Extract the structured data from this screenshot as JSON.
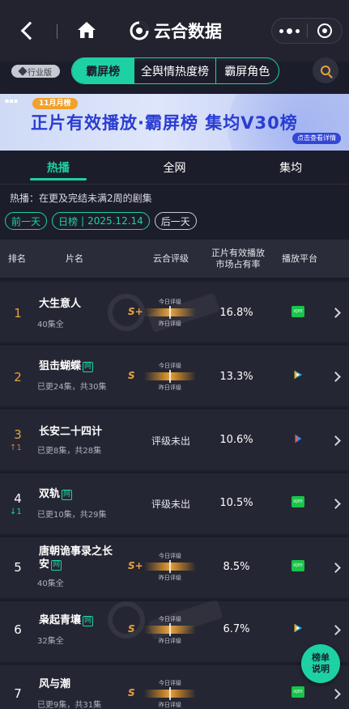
{
  "topbar": {
    "app_name": "云合数据",
    "icons": [
      "back-arrow-icon",
      "home-icon",
      "yunhe-logo-icon",
      "more-dots-icon",
      "target-icon"
    ]
  },
  "tabs": {
    "badge": "行业版",
    "items": [
      "霸屏榜",
      "全舆情热度榜",
      "霸屏角色"
    ],
    "active_index": 0,
    "search_icon": "search-icon"
  },
  "banner": {
    "tag": "11月月榜",
    "headline": "正片有效播放·霸屏榜 集均V30榜",
    "link": "点击查看详情"
  },
  "subtabs": {
    "items": [
      "热播",
      "全网",
      "集均"
    ],
    "active_index": 0
  },
  "description": "热播：在更及完结未满2周的剧集",
  "dates": {
    "prev": "前一天",
    "daily_label": "日榜",
    "date": "2025.12.14",
    "next": "后一天"
  },
  "table": {
    "headers": {
      "rank": "排名",
      "title": "片名",
      "grade": "云合评级",
      "share_line1": "正片有效播放",
      "share_line2": "市场占有率",
      "platform": "播放平台"
    },
    "gauge_today": "今日评级",
    "gauge_yesterday": "昨日评级",
    "rows": [
      {
        "rank": "1",
        "title": "大生意人",
        "network_tag": "",
        "episodes": "40集全",
        "grade": "S+",
        "grade_text": "",
        "share": "16.8%",
        "platform": "iqiyi",
        "delta": "",
        "delta_dir": ""
      },
      {
        "rank": "2",
        "title": "狙击蝴蝶",
        "network_tag": "网",
        "episodes": "已更24集，共30集",
        "grade": "S",
        "grade_text": "",
        "share": "13.3%",
        "platform": "tencent",
        "delta": "",
        "delta_dir": ""
      },
      {
        "rank": "3",
        "title": "长安二十四计",
        "network_tag": "",
        "episodes": "已更8集，共28集",
        "grade": "",
        "grade_text": "评级未出",
        "share": "10.6%",
        "platform": "youku",
        "delta": "1",
        "delta_dir": "up"
      },
      {
        "rank": "4",
        "title": "双轨",
        "network_tag": "网",
        "episodes": "已更10集，共29集",
        "grade": "",
        "grade_text": "评级未出",
        "share": "10.5%",
        "platform": "iqiyi",
        "delta": "1",
        "delta_dir": "down"
      },
      {
        "rank": "5",
        "title": "唐朝诡事录之长安",
        "network_tag": "网",
        "episodes": "40集全",
        "grade": "S+",
        "grade_text": "",
        "share": "8.5%",
        "platform": "iqiyi",
        "delta": "",
        "delta_dir": ""
      },
      {
        "rank": "6",
        "title": "枭起青壤",
        "network_tag": "网",
        "episodes": "32集全",
        "grade": "S",
        "grade_text": "",
        "share": "6.7%",
        "platform": "tencent",
        "delta": "",
        "delta_dir": ""
      },
      {
        "rank": "7",
        "title": "风与潮",
        "network_tag": "",
        "episodes": "已更9集，共31集",
        "grade": "S",
        "grade_text": "",
        "share": "",
        "platform": "iqiyi",
        "delta": "",
        "delta_dir": ""
      }
    ]
  },
  "float_button": {
    "line1": "榜单",
    "line2": "说明"
  },
  "colors": {
    "accent": "#1ed1a5",
    "gold": "#e7a23f",
    "background": "#1c1d2a",
    "row": "#252633"
  }
}
